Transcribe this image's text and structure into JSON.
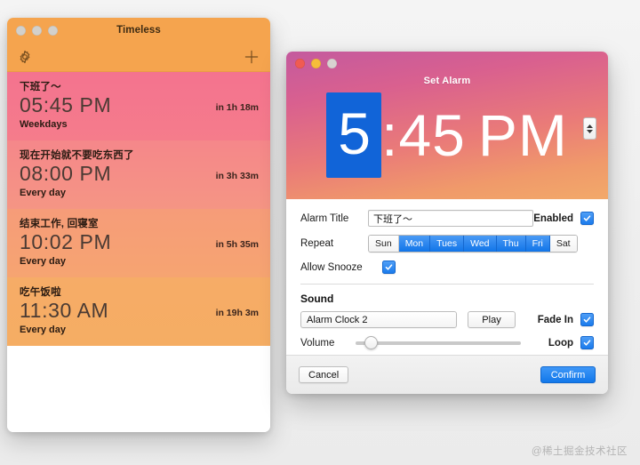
{
  "timeless_window": {
    "title": "Timeless",
    "toolbar": {
      "settings_icon": "gear-icon",
      "add_icon": "plus-icon"
    },
    "alarms": [
      {
        "title": "下班了～",
        "time": "05:45 PM",
        "repeat": "Weekdays",
        "countdown": "in 1h 18m",
        "color_start": "#f4768f",
        "color_end": "#f4788e"
      },
      {
        "title": "现在开始就不要吃东西了",
        "time": "08:00 PM",
        "repeat": "Every day",
        "countdown": "in 3h 33m",
        "color_start": "#f58a85",
        "color_end": "#f5938a"
      },
      {
        "title": "结束工作, 回寝室",
        "time": "10:02 PM",
        "repeat": "Every day",
        "countdown": "in 5h 35m",
        "color_start": "#f69a78",
        "color_end": "#f6a271"
      },
      {
        "title": "吃午饭啦",
        "time": "11:30 AM",
        "repeat": "Every day",
        "countdown": "in 19h 3m",
        "color_start": "#f6ab68",
        "color_end": "#f5ad63"
      }
    ]
  },
  "set_alarm_window": {
    "title": "Set Alarm",
    "clock": {
      "hour": "5",
      "separator": ":",
      "minute": "45",
      "meridiem": "PM",
      "stepper_icon": "stepper-up-down-icon"
    },
    "fields": {
      "alarm_title_label": "Alarm Title",
      "alarm_title_value": "下班了～",
      "alarm_title_placeholder": "Alarm Title",
      "enabled_label": "Enabled",
      "enabled_checked": true,
      "repeat_label": "Repeat",
      "repeat_days": [
        {
          "label": "Sun",
          "selected": false
        },
        {
          "label": "Mon",
          "selected": true
        },
        {
          "label": "Tues",
          "selected": true
        },
        {
          "label": "Wed",
          "selected": true
        },
        {
          "label": "Thu",
          "selected": true
        },
        {
          "label": "Fri",
          "selected": true
        },
        {
          "label": "Sat",
          "selected": false
        }
      ],
      "allow_snooze_label": "Allow Snooze",
      "allow_snooze_checked": true
    },
    "sound": {
      "section_title": "Sound",
      "selected_sound": "Alarm Clock 2",
      "play_label": "Play",
      "fade_in_label": "Fade In",
      "fade_in_checked": true,
      "volume_label": "Volume",
      "volume_percent": 6,
      "loop_label": "Loop",
      "loop_checked": true
    },
    "footer": {
      "cancel_label": "Cancel",
      "confirm_label": "Confirm"
    }
  },
  "watermark": "@稀土掘金技术社区",
  "colors": {
    "accent_blue": "#1b7bec",
    "timeless_header": "#f5a44e"
  }
}
